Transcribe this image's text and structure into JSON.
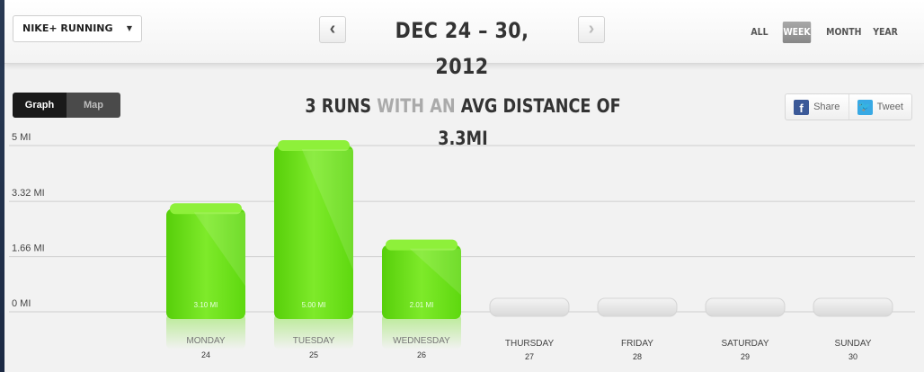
{
  "header": {
    "app_select": "NIKE+ RUNNING",
    "date_range": "DEC 24 – 30, 2012",
    "prev_symbol": "‹",
    "next_symbol": "›",
    "periods": [
      {
        "label": "ALL",
        "active": false
      },
      {
        "label": "WEEK",
        "active": true
      },
      {
        "label": "MONTH",
        "active": false
      },
      {
        "label": "YEAR",
        "active": false
      }
    ]
  },
  "view_toggle": {
    "graph": "Graph",
    "map": "Map",
    "selected": "Graph"
  },
  "summary": {
    "part1": "3 RUNS ",
    "part2": "WITH AN ",
    "part3": "AVG DISTANCE OF 3.3MI"
  },
  "share": {
    "facebook": "Share",
    "twitter": "Tweet"
  },
  "colors": {
    "bar": "#5ed80f",
    "bar_light": "#8ef03a",
    "empty_bar": "#e3e3e3",
    "grid": "#cfcfcf"
  },
  "chart_data": {
    "type": "bar",
    "categories": [
      "MONDAY",
      "TUESDAY",
      "WEDNESDAY",
      "THURSDAY",
      "FRIDAY",
      "SATURDAY",
      "SUNDAY"
    ],
    "dates": [
      "24",
      "25",
      "26",
      "27",
      "28",
      "29",
      "30"
    ],
    "values": [
      3.1,
      5.0,
      2.01,
      0,
      0,
      0,
      0
    ],
    "value_labels": [
      "3.10 MI",
      "5.00 MI",
      "2.01 MI",
      "",
      "",
      "",
      ""
    ],
    "y_ticks": [
      {
        "value": 5,
        "label": "5 MI"
      },
      {
        "value": 3.32,
        "label": "3.32 MI"
      },
      {
        "value": 1.66,
        "label": "1.66 MI"
      },
      {
        "value": 0,
        "label": "0 MI"
      }
    ],
    "ylim": [
      0,
      5
    ],
    "grid": true
  }
}
